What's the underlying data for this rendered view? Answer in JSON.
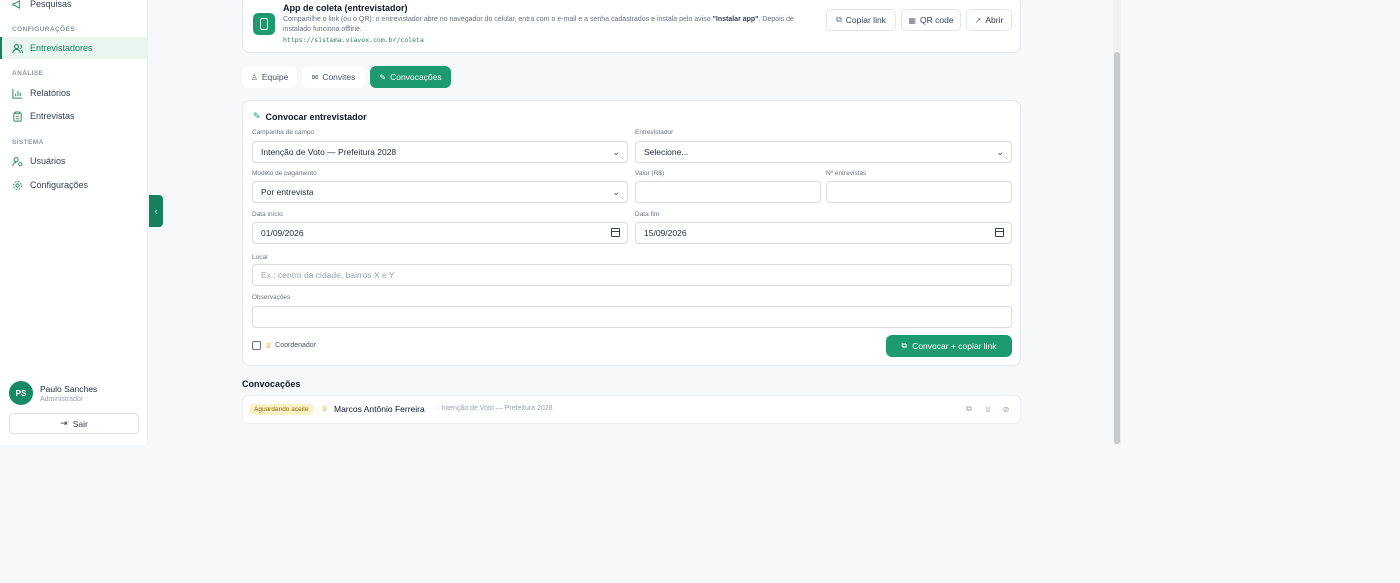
{
  "sidebar": {
    "top_item": "Pesquisas",
    "sections": [
      {
        "label": "CONFIGURAÇÕES",
        "items": [
          {
            "label": "Entrevistadores",
            "icon": "users-icon",
            "active": true
          }
        ]
      },
      {
        "label": "ANÁLISE",
        "items": [
          {
            "label": "Relatórios",
            "icon": "chart-icon"
          },
          {
            "label": "Entrevistas",
            "icon": "clipboard-icon"
          }
        ]
      },
      {
        "label": "SISTEMA",
        "items": [
          {
            "label": "Usuários",
            "icon": "user-gear-icon"
          },
          {
            "label": "Configurações",
            "icon": "gear-icon"
          }
        ]
      }
    ],
    "user": {
      "initials": "PS",
      "name": "Paulo Sanches",
      "role": "Administrador"
    },
    "logout": "Sair"
  },
  "app_card": {
    "title": "App de coleta (entrevistador)",
    "desc_pre": "Compartilhe o link (ou o QR): o entrevistador abre no navegador do celular, entra com o e-mail e a senha cadastrados e instala pelo aviso ",
    "desc_bold": "\"Instalar app\"",
    "desc_post": ". Depois de instalado funciona offline.",
    "url": "https://sistema.viavox.com.br/coleta",
    "buttons": {
      "copy": "Copiar link",
      "qr": "QR code",
      "open": "Abrir"
    }
  },
  "tabs": [
    {
      "label": "Equipe"
    },
    {
      "label": "Convites"
    },
    {
      "label": "Convocações",
      "active": true
    }
  ],
  "form": {
    "title": "Convocar entrevistador",
    "campanha": {
      "label": "Campanha de campo",
      "value": "Intenção de Voto — Prefeitura 2028"
    },
    "entrevistador": {
      "label": "Entrevistador",
      "value": "Selecione..."
    },
    "modelo": {
      "label": "Modelo de pagamento",
      "value": "Por entrevista"
    },
    "valor": {
      "label": "Valor (R$)",
      "value": ""
    },
    "n_entrevistas": {
      "label": "Nº entrevistas",
      "value": ""
    },
    "data_inicio": {
      "label": "Data início",
      "value": "01/09/2026"
    },
    "data_fim": {
      "label": "Data fim",
      "value": "15/09/2026"
    },
    "local": {
      "label": "Local",
      "placeholder": "Ex.: centro da cidade, bairros X e Y"
    },
    "observacoes": {
      "label": "Observações",
      "value": ""
    },
    "coordenador": {
      "label": "Coordenador",
      "checked": false
    },
    "submit": "Convocar + copiar link"
  },
  "convocacoes": {
    "title": "Convocações",
    "rows": [
      {
        "status": "Aguardando aceite",
        "name": "Marcos Antônio Ferreira",
        "campaign": "· Intenção de Voto — Prefeitura 2028"
      }
    ]
  },
  "colors": {
    "accent": "#1d9a70",
    "accent_dark": "#17805f",
    "badge_bg": "#fdf1c7",
    "star": "#d4a514"
  }
}
